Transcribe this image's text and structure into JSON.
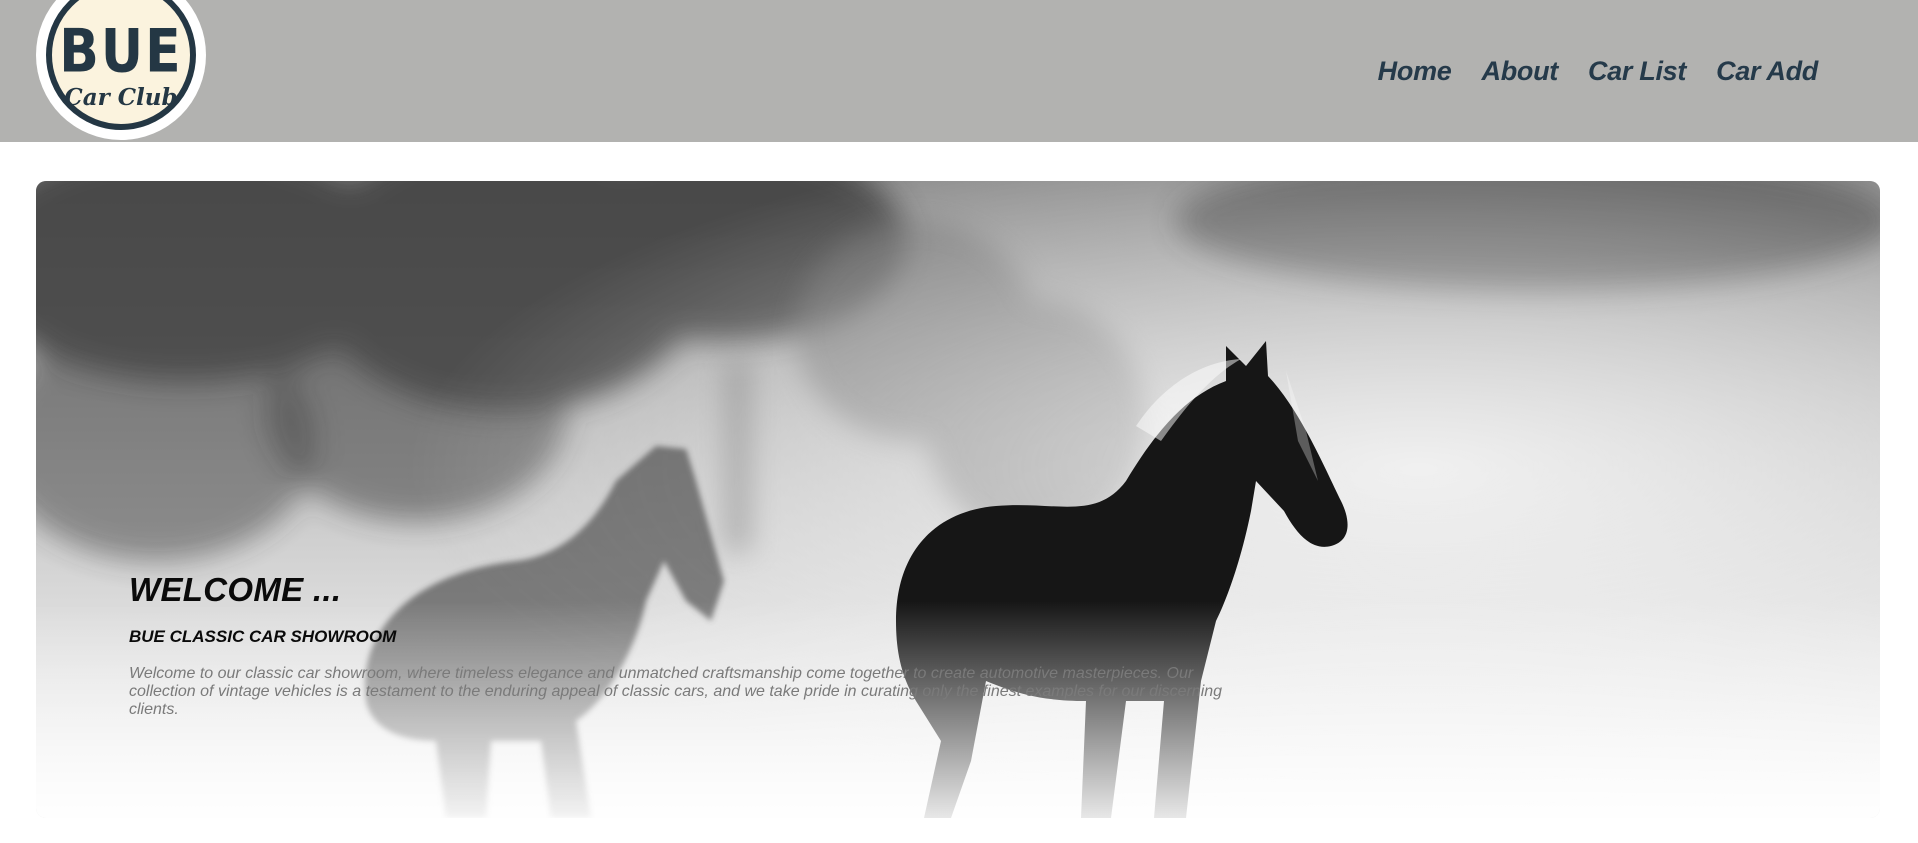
{
  "header": {
    "logo": {
      "top_text": "BUE",
      "bottom_text": "Car Club"
    },
    "nav": [
      {
        "label": "Home"
      },
      {
        "label": "About"
      },
      {
        "label": "Car List"
      },
      {
        "label": "Car Add"
      }
    ],
    "colors": {
      "background": "#b2b2b0",
      "nav_text": "#253a4a"
    }
  },
  "hero": {
    "image": "horses-running-in-dust",
    "title": "WELCOME ...",
    "subtitle": "BUE CLASSIC CAR SHOWROOM",
    "body": "Welcome to our classic car showroom, where timeless elegance and unmatched craftsmanship come together to create automotive masterpieces. Our collection of vintage vehicles is a testament to the enduring appeal of classic cars, and we take pride in curating only the finest examples for our discerning clients."
  }
}
